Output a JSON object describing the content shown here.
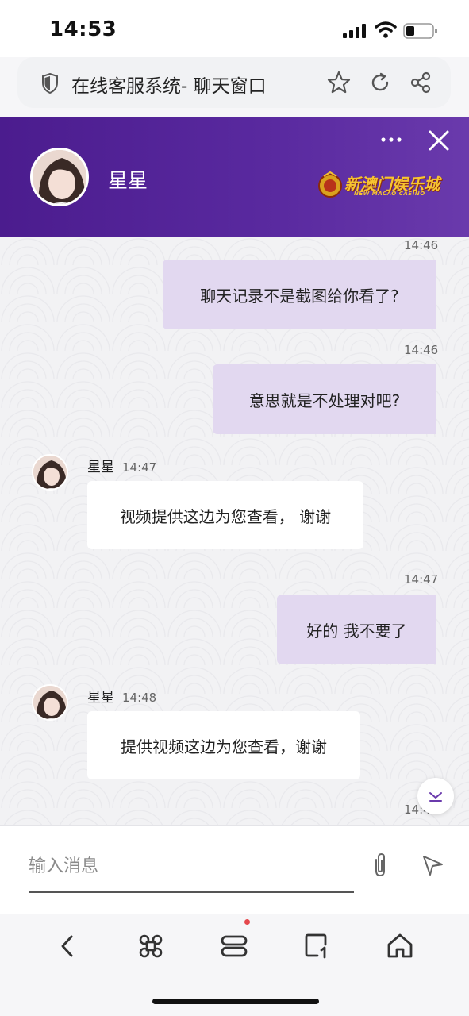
{
  "status_bar": {
    "time": "14:53"
  },
  "url_bar": {
    "title": "在线客服系统- 聊天窗口"
  },
  "header": {
    "agent_name": "星星",
    "logo_text": "新澳门娱乐城",
    "logo_subtext": "NEW MACAO CASINO"
  },
  "messages": [
    {
      "side": "out",
      "time": "14:46",
      "text": "聊天记录不是截图给你看了?"
    },
    {
      "side": "out",
      "time": "14:46",
      "text": "意思就是不处理对吧?"
    },
    {
      "side": "in",
      "sender": "星星",
      "time": "14:47",
      "text": "视频提供这边为您查看， 谢谢"
    },
    {
      "side": "out",
      "time": "14:47",
      "text": "好的 我不要了"
    },
    {
      "side": "in",
      "sender": "星星",
      "time": "14:48",
      "text": "提供视频这边为您查看，谢谢"
    },
    {
      "side": "out",
      "time": "14:49",
      "text": ""
    }
  ],
  "composer": {
    "placeholder": "输入消息"
  },
  "colors": {
    "header_purple": "#4b1c8e",
    "outgoing_bubble": "#e2d8f0",
    "incoming_bubble": "#ffffff",
    "notification_dot": "#e5484d"
  },
  "icons": [
    "shield-icon",
    "star-icon",
    "reload-icon",
    "share-icon",
    "more-icon",
    "close-icon",
    "scroll-down-icon",
    "attachment-icon",
    "send-icon",
    "back-icon",
    "command-icon",
    "tabs-icon",
    "new-tab-icon",
    "home-icon"
  ]
}
